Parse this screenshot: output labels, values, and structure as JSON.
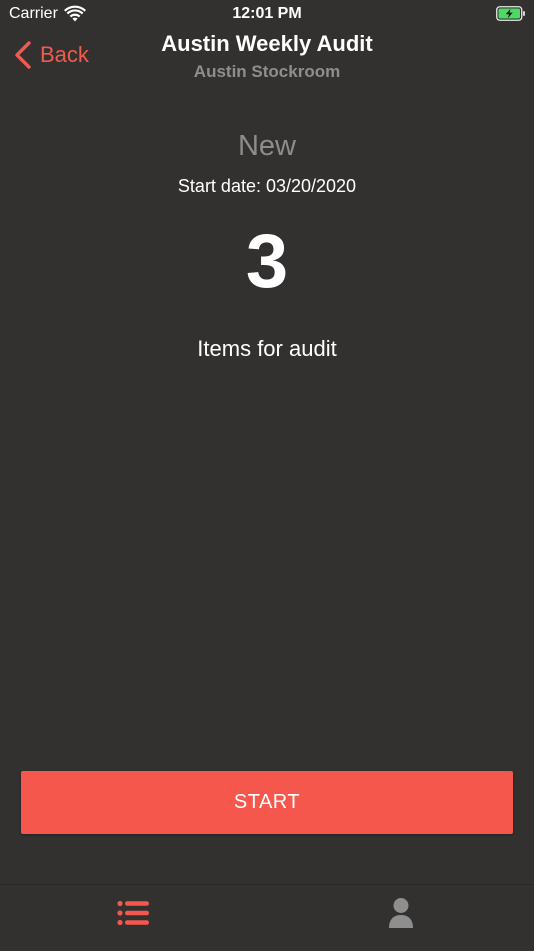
{
  "status_bar": {
    "carrier": "Carrier",
    "time": "12:01 PM"
  },
  "nav": {
    "back_label": "Back",
    "title": "Austin Weekly Audit",
    "subtitle": "Austin Stockroom"
  },
  "audit": {
    "status": "New",
    "start_date": "Start date: 03/20/2020",
    "item_count": "3",
    "items_label": "Items for audit"
  },
  "actions": {
    "start_label": "START"
  },
  "tabs": [
    {
      "icon": "list-icon",
      "active": true
    },
    {
      "icon": "person-icon",
      "active": false
    }
  ],
  "colors": {
    "background": "#323130",
    "accent": "#f5574d",
    "back_text": "#f15a50",
    "muted_text": "#8e8e8e",
    "battery_charging": "#4cd964"
  }
}
